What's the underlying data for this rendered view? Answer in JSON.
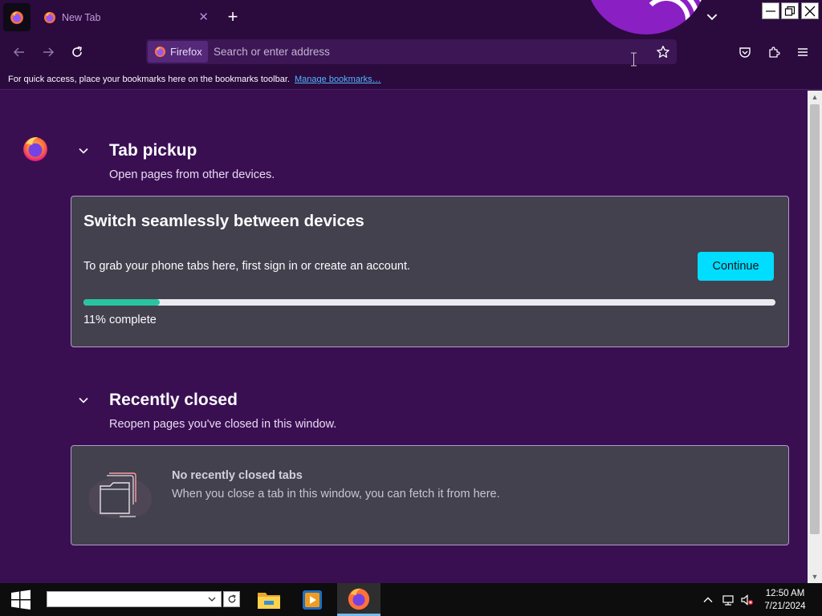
{
  "browser": {
    "tab": {
      "title": "New Tab",
      "close_glyph": "✕"
    },
    "new_tab_glyph": "+",
    "urlbar": {
      "identity_label": "Firefox",
      "placeholder": "Search or enter address",
      "value": ""
    }
  },
  "bookmarks_notice": {
    "text": "For quick access, place your bookmarks here on the bookmarks toolbar.",
    "link": "Manage bookmarks…"
  },
  "tab_pickup": {
    "title": "Tab pickup",
    "subtitle": "Open pages from other devices.",
    "card_title": "Switch seamlessly between devices",
    "card_text": "To grab your phone tabs here, first sign in or create an account.",
    "button": "Continue",
    "progress_fraction": 0.11,
    "progress_label": "11% complete"
  },
  "recently_closed": {
    "title": "Recently closed",
    "subtitle": "Reopen pages you've closed in this window.",
    "empty_title": "No recently closed tabs",
    "empty_text": "When you close a tab in this window, you can fetch it from here."
  },
  "taskbar": {
    "search_value": "",
    "time": "12:50 AM",
    "date": "7/21/2024"
  },
  "colors": {
    "accent_button": "#00ddff",
    "progress_fill": "#2ac3a2",
    "theme_background": "#3a0f52",
    "toolbar_background": "#2b0a3d",
    "link": "#52b6ff"
  },
  "icons": [
    "firefox-icon",
    "close-icon",
    "plus-icon",
    "chevron-down-icon",
    "back-arrow-icon",
    "forward-arrow-icon",
    "reload-icon",
    "star-icon",
    "pocket-icon",
    "extensions-icon",
    "hamburger-menu-icon",
    "windows-start-icon",
    "file-explorer-icon",
    "media-player-icon",
    "network-icon",
    "volume-muted-icon"
  ]
}
